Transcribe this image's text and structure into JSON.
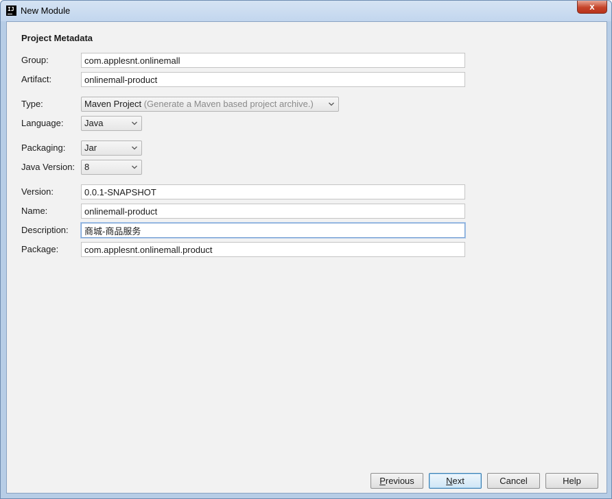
{
  "window": {
    "title": "New Module",
    "app_icon": "intellij-icon",
    "app_icon_text": "IJ",
    "close_symbol": "x"
  },
  "form": {
    "section_title": "Project Metadata",
    "group": {
      "label": "Group:",
      "value": "com.applesnt.onlinemall"
    },
    "artifact": {
      "label": "Artifact:",
      "value": "onlinemall-product"
    },
    "type": {
      "label": "Type:",
      "value": "Maven Project",
      "hint": "(Generate a Maven based project archive.)"
    },
    "language": {
      "label": "Language:",
      "value": "Java"
    },
    "packaging": {
      "label": "Packaging:",
      "value": "Jar"
    },
    "java_version": {
      "label": "Java Version:",
      "value": "8"
    },
    "version": {
      "label": "Version:",
      "value": "0.0.1-SNAPSHOT"
    },
    "name": {
      "label": "Name:",
      "value": "onlinemall-product"
    },
    "description": {
      "label": "Description:",
      "value": "商城-商品服务"
    },
    "package": {
      "label": "Package:",
      "value": "com.applesnt.onlinemall.product"
    }
  },
  "buttons": {
    "previous": {
      "mnemonic": "P",
      "rest": "revious"
    },
    "next": {
      "mnemonic": "N",
      "rest": "ext"
    },
    "cancel": "Cancel",
    "help": "Help"
  },
  "colors": {
    "title_bar": "#c9dcf2",
    "dialog_background": "#f2f2f2",
    "close_button": "#c5442a",
    "focus_border": "#7aa3d4"
  }
}
